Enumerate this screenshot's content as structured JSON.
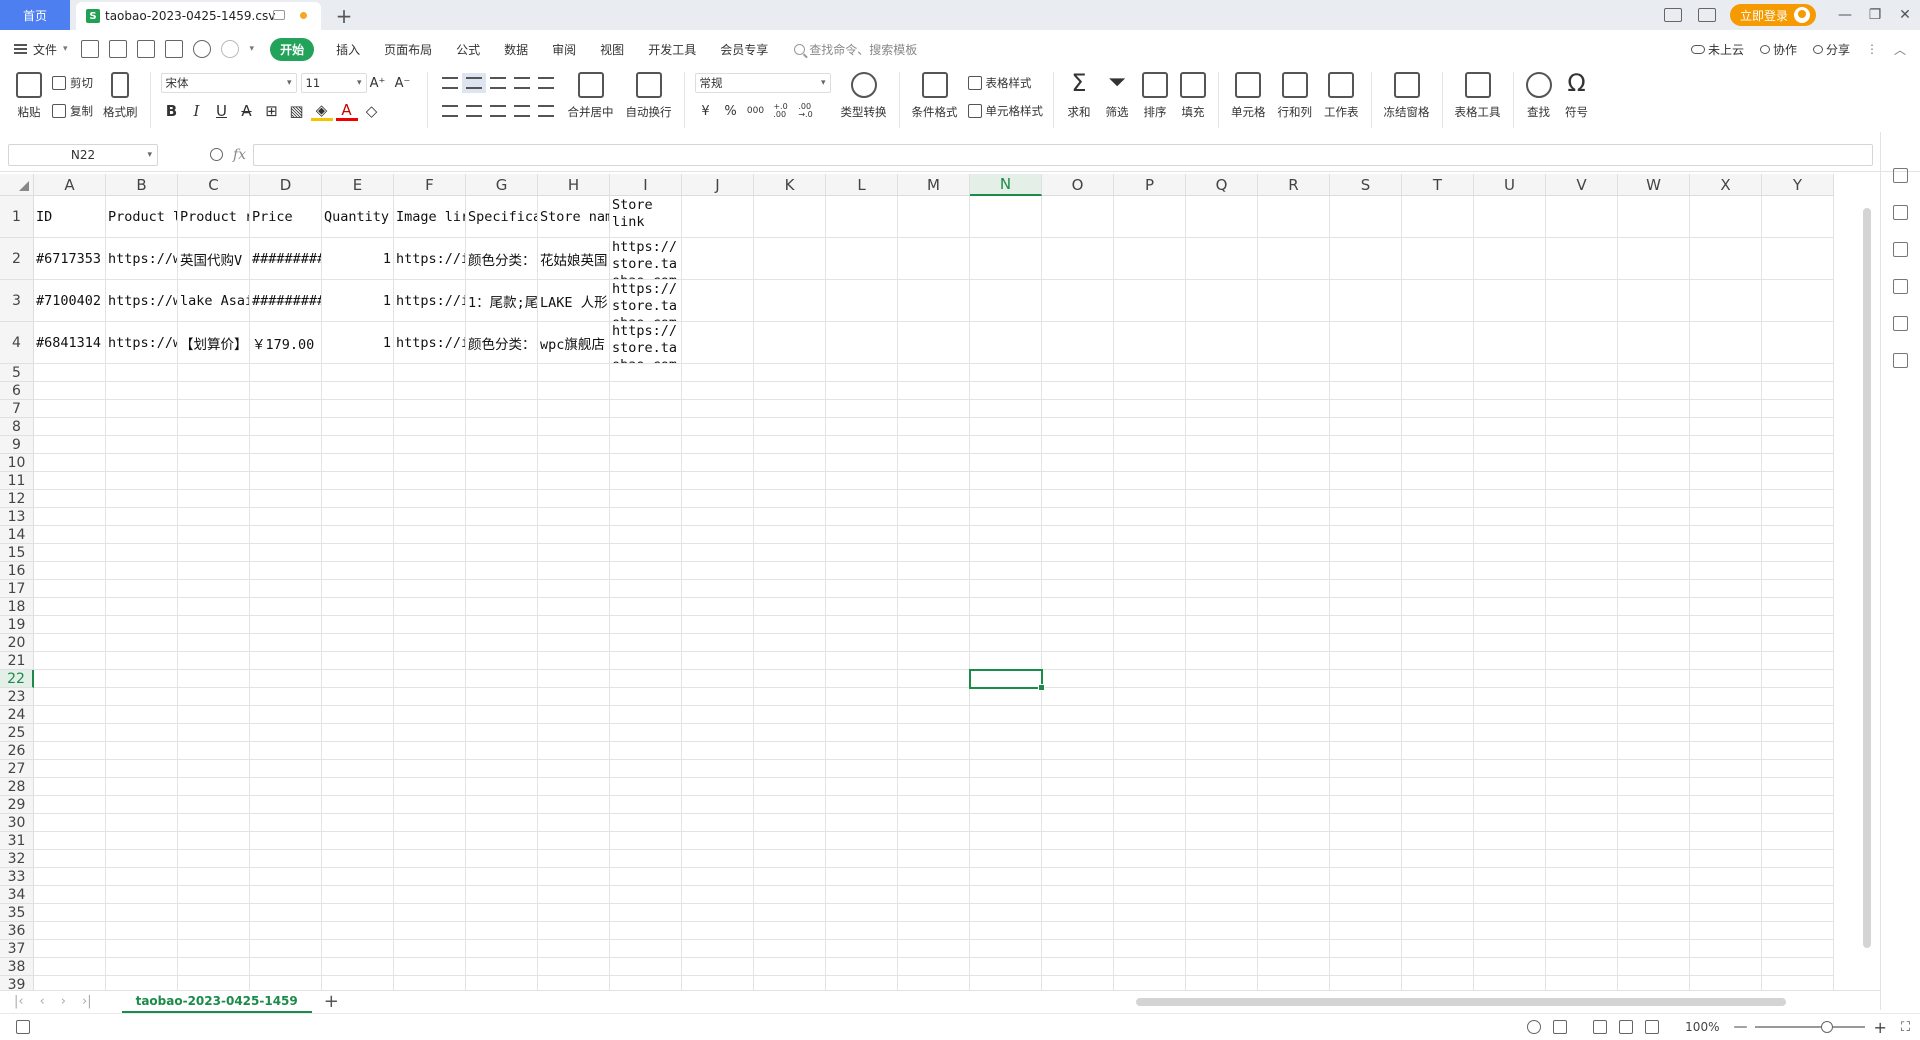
{
  "tabs": {
    "home": "首页",
    "document": "taobao-2023-0425-1459.csv",
    "login": "立即登录"
  },
  "menu": {
    "file": "文件",
    "start": "开始",
    "items": [
      "插入",
      "页面布局",
      "公式",
      "数据",
      "审阅",
      "视图",
      "开发工具",
      "会员专享"
    ],
    "search": "查找命令、搜索模板",
    "cloud": "未上云",
    "collab": "协作",
    "share": "分享"
  },
  "ribbon": {
    "paste": "粘贴",
    "cut": "剪切",
    "copy": "复制",
    "format_painter": "格式刷",
    "font_name": "宋体",
    "font_size": "11",
    "merge_center": "合并居中",
    "wrap_text": "自动换行",
    "number_format": "常规",
    "type_convert": "类型转换",
    "cond_format": "条件格式",
    "table_style": "表格样式",
    "cell_style": "单元格样式",
    "sum": "求和",
    "filter": "筛选",
    "sort": "排序",
    "fill": "填充",
    "cell": "单元格",
    "row_col": "行和列",
    "worksheet": "工作表",
    "freeze": "冻结窗格",
    "table_tools": "表格工具",
    "find": "查找",
    "symbol": "符号",
    "currency": "¥",
    "percent": "%",
    "thousands": "000",
    "dec_plus": "+.0\n.00",
    "dec_minus": ".00\n→.0"
  },
  "formula_bar": {
    "name_box": "N22",
    "fx": "fx",
    "content": ""
  },
  "grid": {
    "columns": [
      "A",
      "B",
      "C",
      "D",
      "E",
      "F",
      "G",
      "H",
      "I",
      "J",
      "K",
      "L",
      "M",
      "N",
      "O",
      "P",
      "Q",
      "R",
      "S",
      "T",
      "U",
      "V",
      "W",
      "X",
      "Y"
    ],
    "selected_column": "N",
    "selected_row": 22,
    "total_rows": 39,
    "rows": [
      [
        "ID",
        "Product l",
        "Product r",
        "Price",
        "Quantity",
        "Image lir",
        "Specifica",
        "Store nam",
        "Store\nlink"
      ],
      [
        "#6717353",
        "https://w",
        "英国代购V",
        "#########",
        "1",
        "https://i",
        "颜色分类：",
        "花姑娘英国",
        "https://\nstore.ta\nobao.com"
      ],
      [
        "#7100402",
        "https://w",
        "lake Asai",
        "#########",
        "1",
        "https://i",
        "1：尾款;尾",
        "LAKE 人形",
        "https://\nstore.ta\nobao.com"
      ],
      [
        "#6841314",
        "https://w",
        "【划算价】",
        "￥179.00",
        "1",
        "https://i",
        "颜色分类：",
        "wpc旗舰店",
        "https://\nstore.ta\nobao.com"
      ]
    ]
  },
  "sheets": [
    "taobao-2023-0425-1459"
  ],
  "status": {
    "zoom": "100%"
  }
}
